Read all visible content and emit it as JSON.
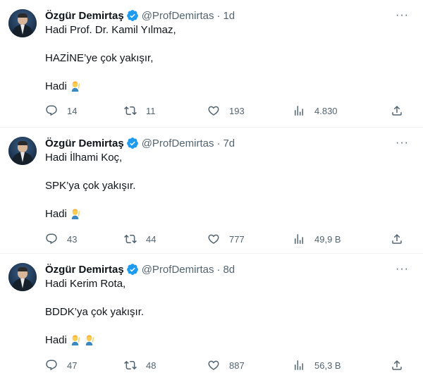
{
  "tweets": [
    {
      "author": {
        "name": "Özgür Demirtaş",
        "handle": "@ProfDemirtas"
      },
      "time": "1d",
      "text": "Hadi Prof. Dr. Kamil Yılmaz,\n\nHAZİNE’ye çok yakışır,\n\nHadi",
      "emojis": [
        "person-raising-hand"
      ],
      "stats": {
        "replies": "14",
        "retweets": "11",
        "likes": "193",
        "views": "4.830"
      }
    },
    {
      "author": {
        "name": "Özgür Demirtaş",
        "handle": "@ProfDemirtas"
      },
      "time": "7d",
      "text": "Hadi İlhami Koç,\n\nSPK’ya çok yakışır.\n\nHadi",
      "emojis": [
        "person-raising-hand"
      ],
      "stats": {
        "replies": "43",
        "retweets": "44",
        "likes": "777",
        "views": "49,9 B"
      }
    },
    {
      "author": {
        "name": "Özgür Demirtaş",
        "handle": "@ProfDemirtas"
      },
      "time": "8d",
      "text": "Hadi Kerim Rota,\n\nBDDK’ya çok yakışır.\n\nHadi",
      "emojis": [
        "person-raising-hand",
        "person-raising-hand"
      ],
      "stats": {
        "replies": "47",
        "retweets": "48",
        "likes": "887",
        "views": "56,3 B"
      }
    }
  ],
  "colors": {
    "accent": "#1d9bf0",
    "muted": "#536471",
    "text": "#0f1419",
    "divider": "#eff3f4"
  }
}
